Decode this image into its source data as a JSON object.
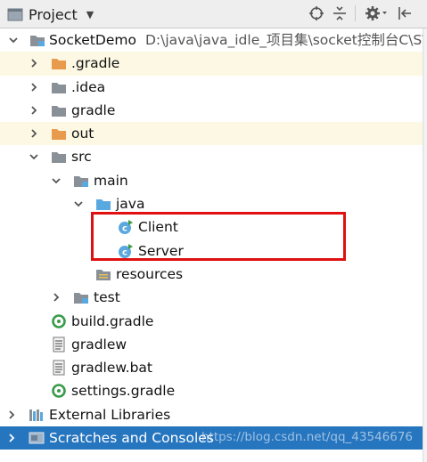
{
  "header": {
    "title": "Project",
    "icons": [
      "project-view-icon",
      "chevron-down-icon",
      "locate-icon",
      "collapse-all-icon",
      "gear-icon",
      "hide-panel-icon"
    ]
  },
  "tree": {
    "root": {
      "label": "SocketDemo",
      "path": "D:\\java\\java_idle_项目集\\socket控制台C\\S\\S"
    },
    "gradle_hidden": ".gradle",
    "idea": ".idea",
    "gradle": "gradle",
    "out": "out",
    "src": "src",
    "main": "main",
    "java": "java",
    "client": "Client",
    "server": "Server",
    "resources": "resources",
    "test": "test",
    "build_gradle": "build.gradle",
    "gradlew": "gradlew",
    "gradlew_bat": "gradlew.bat",
    "settings_gradle": "settings.gradle",
    "external_libraries": "External Libraries",
    "scratches": "Scratches and Consoles"
  },
  "colors": {
    "selection": "#2675bf",
    "excluded_background": "#fdf8e3",
    "annotation_box": "#e01010",
    "folder_gray": "#8a9097",
    "folder_orange": "#e89b4c",
    "source_folder_blue": "#5aa8e0"
  },
  "watermark": "https://blog.csdn.net/qq_43546676"
}
